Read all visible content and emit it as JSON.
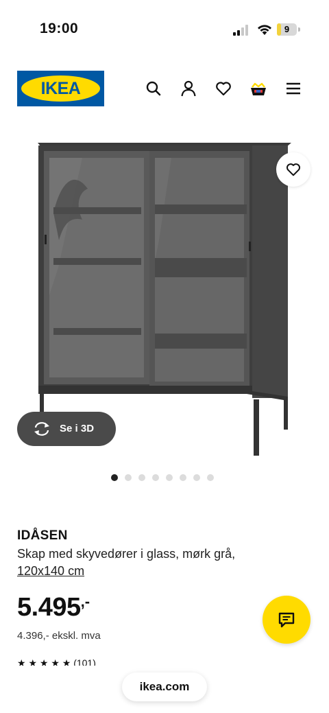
{
  "status_bar": {
    "time": "19:00",
    "battery": "9",
    "battery_level": 0.09
  },
  "header": {
    "logo_text": "IKEA",
    "icons": [
      "search-icon",
      "account-icon",
      "heart-icon",
      "basket-icon",
      "menu-icon"
    ]
  },
  "gallery": {
    "view_3d_label": "Se i 3D",
    "page_count": 8,
    "current_page": 1
  },
  "product": {
    "name": "IDÅSEN",
    "description": "Skap med skyvedører i glass, mørk grå,",
    "size": "120x140 cm",
    "price": "5.495",
    "price_suffix": ",-",
    "price_excl_vat": "4.396,- ekskl. mva",
    "rating_partial": "★ ★ ★ ★ ★  (101)"
  },
  "browser": {
    "url": "ikea.com"
  },
  "colors": {
    "ikea_blue": "#0058a3",
    "ikea_yellow": "#ffdb00",
    "dark_pill": "#4a4a4a"
  }
}
